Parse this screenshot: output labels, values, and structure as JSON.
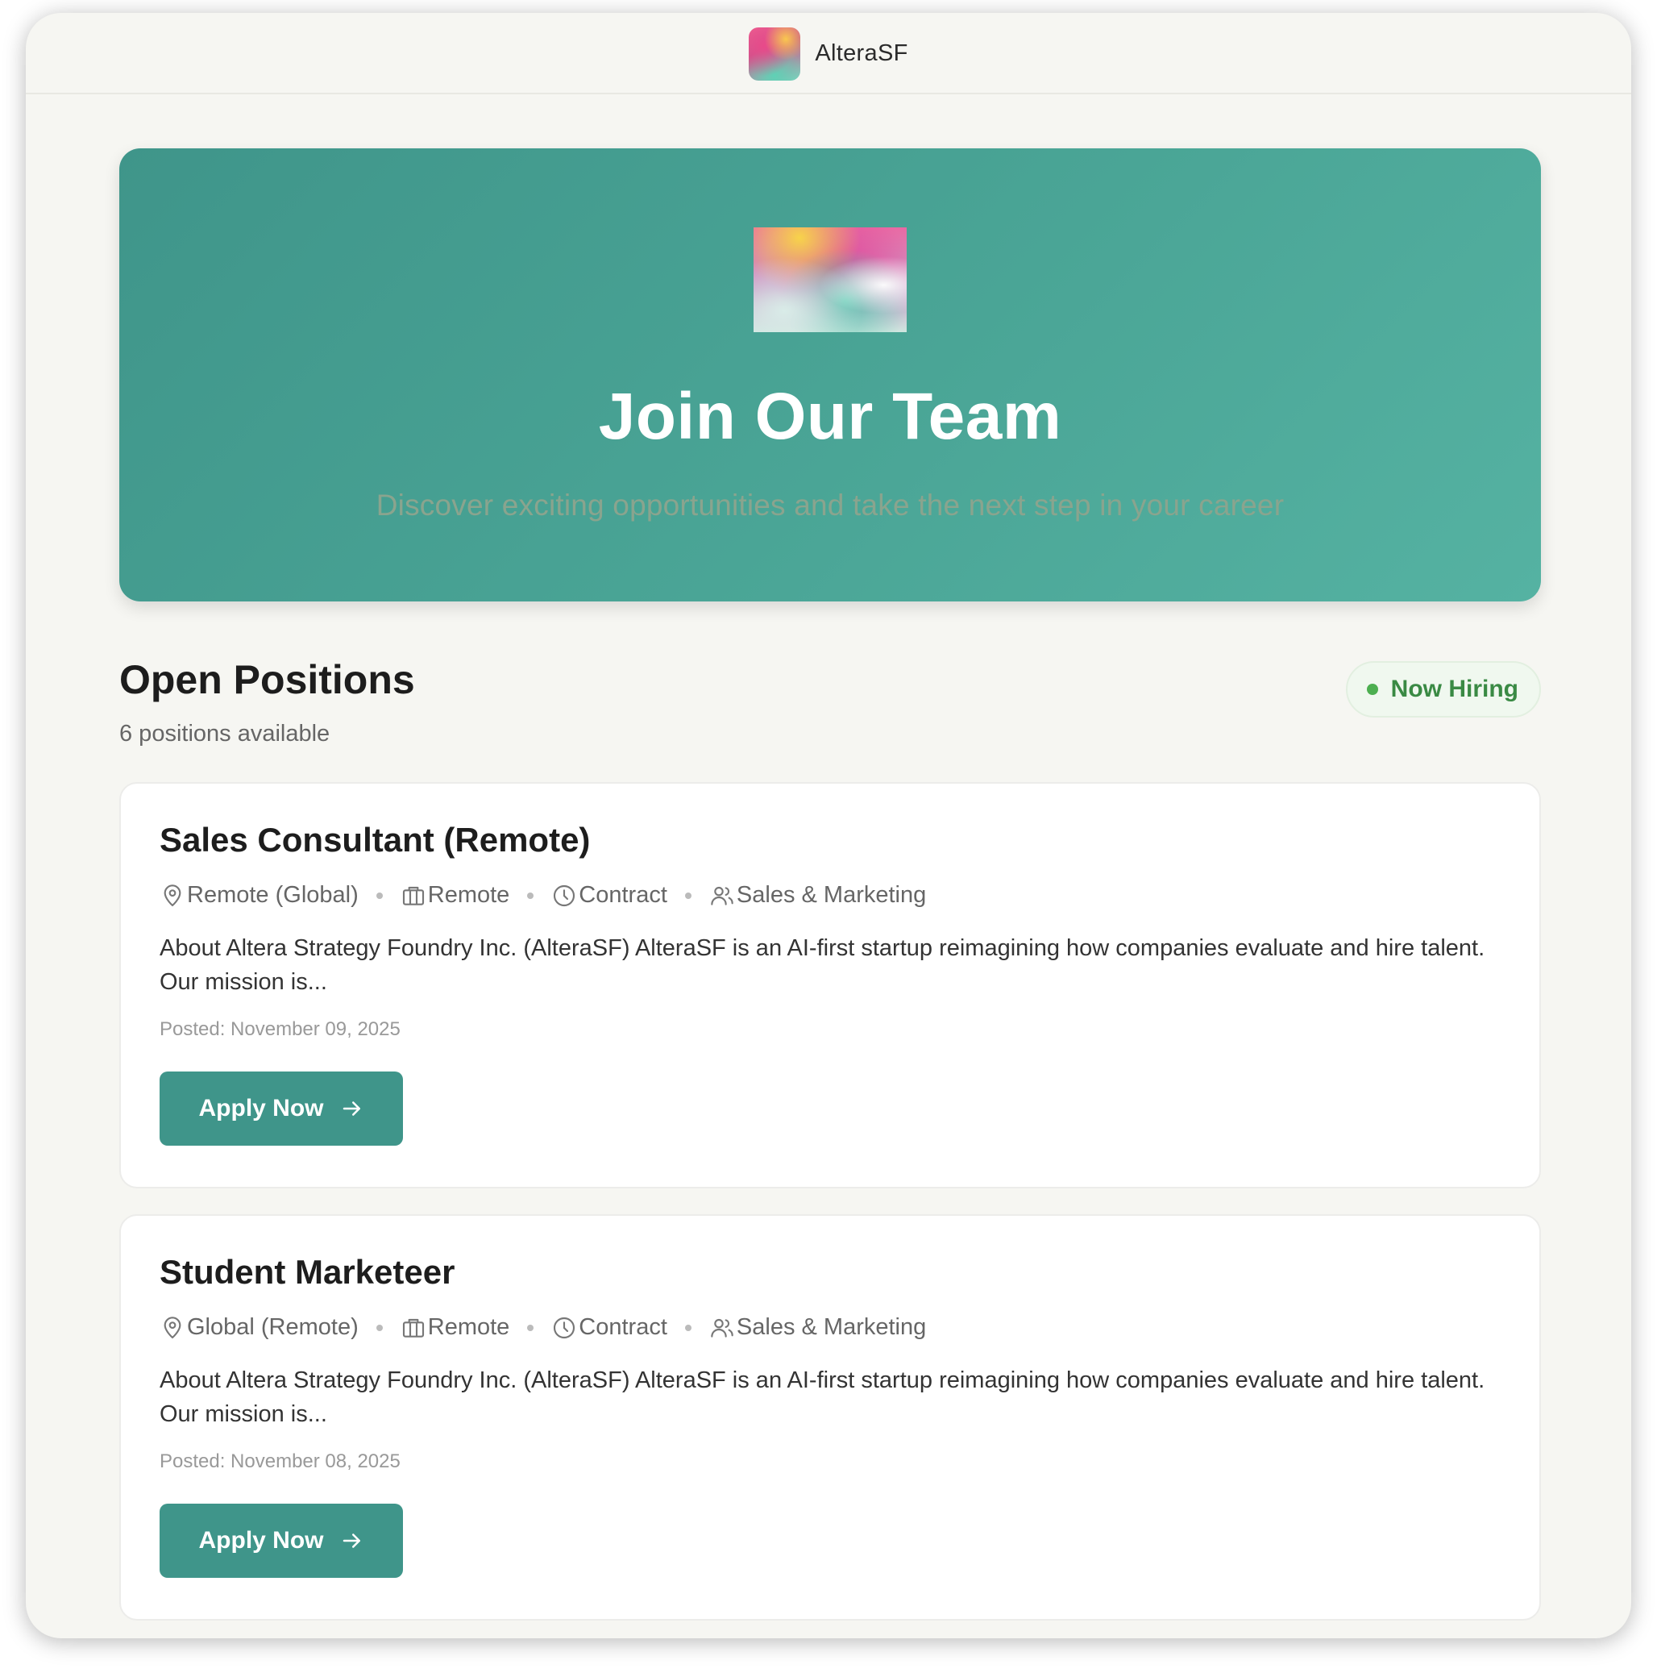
{
  "header": {
    "brand_name": "AlteraSF"
  },
  "hero": {
    "title": "Join Our Team",
    "subtitle": "Discover exciting opportunities and take the next step in your career"
  },
  "positions_section": {
    "title": "Open Positions",
    "count_text": "6 positions available",
    "badge": "Now Hiring"
  },
  "jobs": [
    {
      "title": "Sales Consultant (Remote)",
      "location": "Remote (Global)",
      "workplace": "Remote",
      "type": "Contract",
      "department": "Sales & Marketing",
      "description": "About Altera Strategy Foundry Inc. (AlteraSF) AlteraSF is an AI-first startup reimagining how companies evaluate and hire talent. Our mission is...",
      "posted": "Posted: November 09, 2025",
      "apply_label": "Apply Now"
    },
    {
      "title": "Student Marketeer",
      "location": "Global (Remote)",
      "workplace": "Remote",
      "type": "Contract",
      "department": "Sales & Marketing",
      "description": "About Altera Strategy Foundry Inc. (AlteraSF) AlteraSF is an AI-first startup reimagining how companies evaluate and hire talent. Our mission is...",
      "posted": "Posted: November 08, 2025",
      "apply_label": "Apply Now"
    }
  ],
  "colors": {
    "accent": "#3f958a",
    "page_bg": "#f6f6f2",
    "hiring_green": "#4caf50"
  },
  "icons": {
    "location": "map-pin-icon",
    "workplace": "briefcase-icon",
    "type": "clock-icon",
    "department": "users-icon",
    "apply": "arrow-right-icon"
  }
}
